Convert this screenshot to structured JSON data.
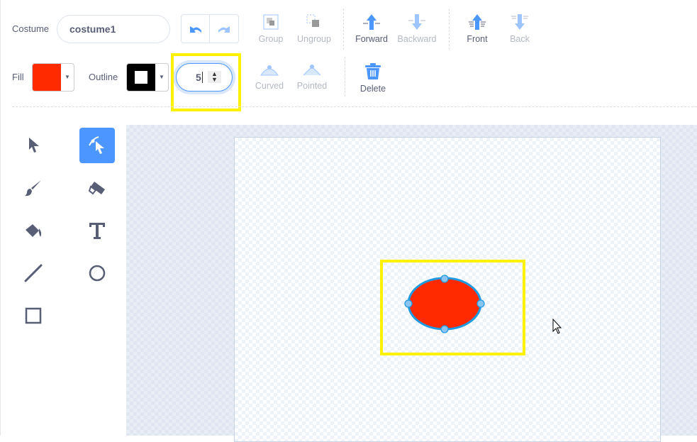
{
  "costume": {
    "label": "Costume",
    "name": "costume1"
  },
  "toolbar": {
    "group": "Group",
    "ungroup": "Ungroup",
    "forward": "Forward",
    "backward": "Backward",
    "front": "Front",
    "back": "Back",
    "curved": "Curved",
    "pointed": "Pointed",
    "delete": "Delete"
  },
  "fill": {
    "label": "Fill",
    "color": "#ff2a00"
  },
  "outline": {
    "label": "Outline",
    "color": "#000000",
    "width": "5"
  },
  "colors": {
    "accent": "#4c97ff",
    "highlight": "#fff200",
    "selection": "#1e9be0"
  },
  "tools": [
    "select",
    "reshape",
    "brush",
    "eraser",
    "fill",
    "text",
    "line",
    "circle",
    "rectangle"
  ],
  "selected_tool": "reshape"
}
